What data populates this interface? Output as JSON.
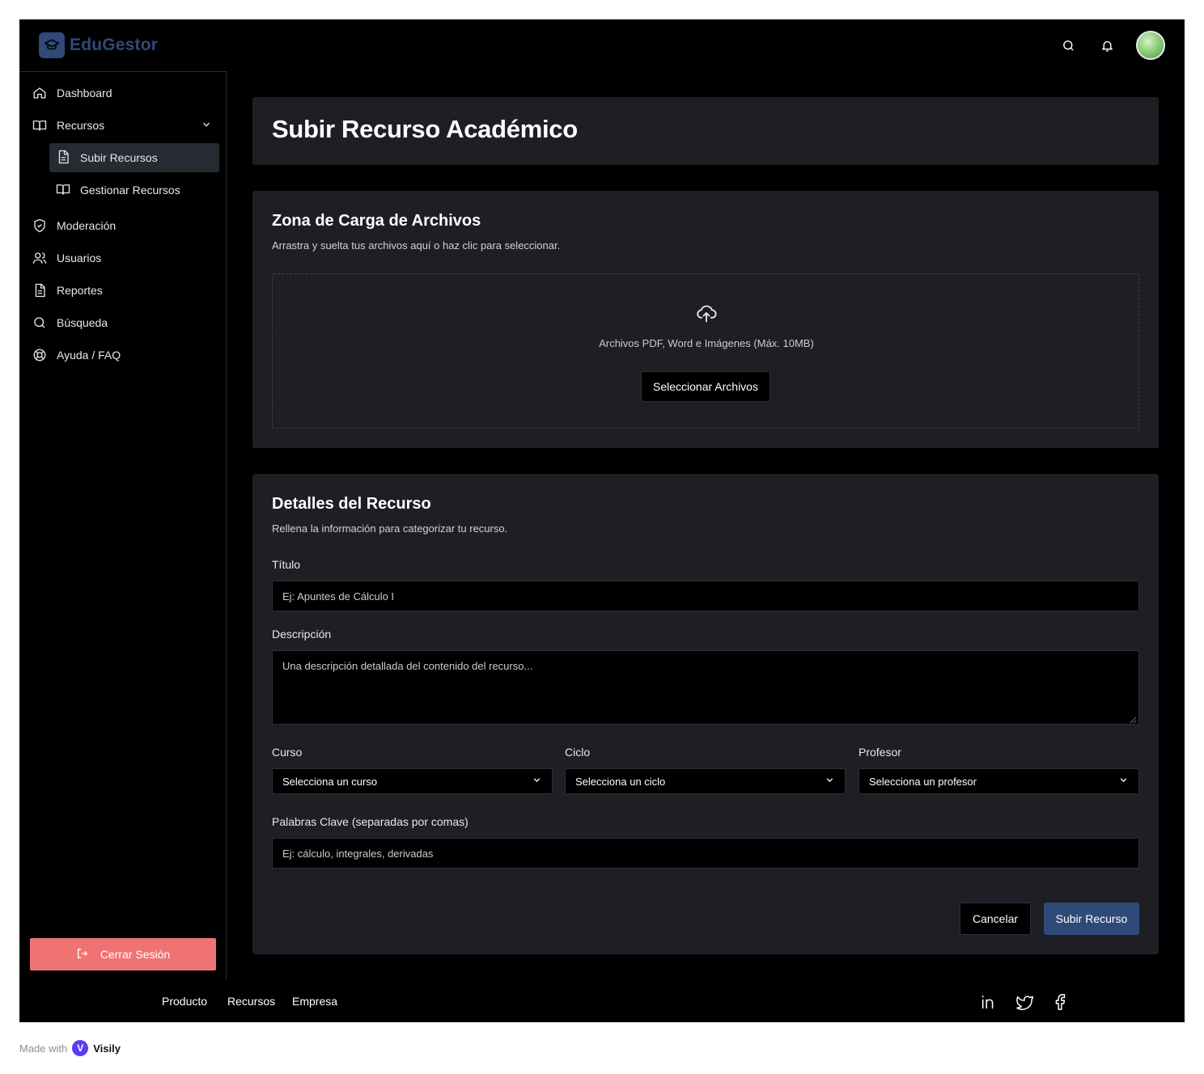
{
  "header": {
    "app_name": "EduGestor",
    "icons": [
      "search-icon",
      "bell-icon"
    ]
  },
  "sidebar": {
    "items": [
      {
        "label": "Dashboard",
        "icon": "home-icon"
      },
      {
        "label": "Recursos",
        "icon": "book-open-icon"
      },
      {
        "label": "Subir Recursos",
        "icon": "file-text-icon"
      },
      {
        "label": "Gestionar Recursos",
        "icon": "book-open-icon"
      },
      {
        "label": "Moderación",
        "icon": "shield-check-icon"
      },
      {
        "label": "Usuarios",
        "icon": "users-icon"
      },
      {
        "label": "Reportes",
        "icon": "file-text-icon"
      },
      {
        "label": "Búsqueda",
        "icon": "search-icon"
      },
      {
        "label": "Ayuda / FAQ",
        "icon": "life-buoy-icon"
      }
    ],
    "logout_label": "Cerrar Sesión"
  },
  "main": {
    "page_title": "Subir Recurso Académico",
    "upload": {
      "title": "Zona de Carga de Archivos",
      "subtitle": "Arrastra y suelta tus archivos aquí o haz clic para seleccionar.",
      "hint": "Archivos PDF, Word e Imágenes (Máx. 10MB)",
      "button_label": "Seleccionar Archivos"
    },
    "details": {
      "title": "Detalles del Recurso",
      "subtitle": "Rellena la información para categorizar tu recurso.",
      "title_label": "Título",
      "title_placeholder": "Ej: Apuntes de Cálculo I",
      "description_label": "Descripción",
      "description_placeholder": "Una descripción detallada del contenido del recurso...",
      "course_label": "Curso",
      "course_value": "Selecciona un curso",
      "cycle_label": "Ciclo",
      "cycle_value": "Selecciona un ciclo",
      "teacher_label": "Profesor",
      "teacher_value": "Selecciona un profesor",
      "keywords_label": "Palabras Clave (separadas por comas)",
      "keywords_placeholder": "Ej: cálculo, integrales, derivadas",
      "cancel_label": "Cancelar",
      "submit_label": "Subir Recurso"
    }
  },
  "footer": {
    "links": [
      "Producto",
      "Recursos",
      "Empresa"
    ],
    "social_icons": [
      "linkedin-icon",
      "twitter-icon",
      "facebook-icon"
    ]
  },
  "badge": {
    "made_with": "Made with",
    "brand": "Visily"
  },
  "colors": {
    "background": "#000000",
    "card": "#1d1f25",
    "accent": "#2f4a78",
    "logout": "#ef7373"
  }
}
